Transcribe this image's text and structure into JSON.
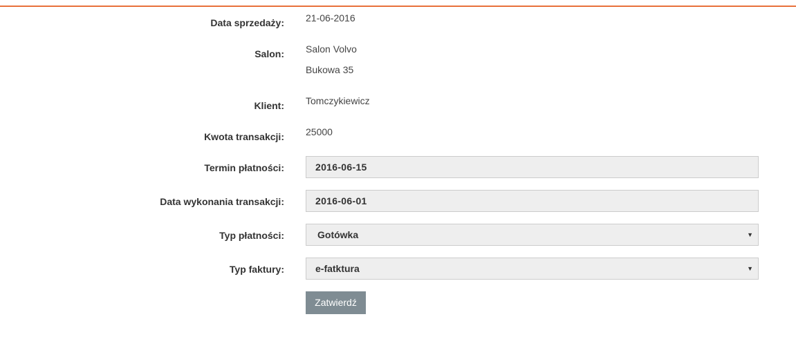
{
  "form": {
    "sale_date_label": "Data sprzedaży:",
    "sale_date_value": "21-06-2016",
    "salon_label": "Salon:",
    "salon_name": "Salon Volvo",
    "salon_address": "Bukowa 35",
    "client_label": "Klient:",
    "client_value": "Tomczykiewicz",
    "amount_label": "Kwota transakcji:",
    "amount_value": "25000",
    "due_date_label": "Termin płatności:",
    "due_date_value": "2016-06-15",
    "transaction_date_label": "Data wykonania transakcji:",
    "transaction_date_value": "2016-06-01",
    "payment_type_label": "Typ płatności:",
    "payment_type_value": "Gotówka",
    "invoice_type_label": "Typ faktury:",
    "invoice_type_value": "e-fatktura",
    "submit_label": "Zatwierdź"
  },
  "colors": {
    "accent": "#e8703a",
    "button": "#7f8c93",
    "field_bg": "#eeeeee"
  },
  "icons": {
    "dropdown": "chevron-down-icon"
  }
}
